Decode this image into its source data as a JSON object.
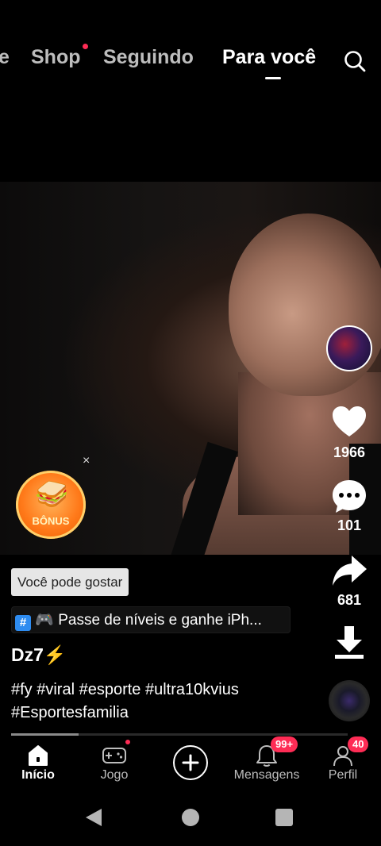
{
  "top_tabs": {
    "partial": "e",
    "shop": "Shop",
    "following": "Seguindo",
    "for_you": "Para você"
  },
  "video": {
    "bonus_label": "BÔNUS",
    "bonus_close": "×"
  },
  "actions": {
    "likes": "1966",
    "comments": "101",
    "shares": "681"
  },
  "caption": {
    "suggestion": "Você pode gostar",
    "game_badge": "#",
    "game_text": "🎮 Passe de níveis e ganhe iPh...",
    "username": "Dz7⚡",
    "hashtags": "#fy #viral #esporte #ultra10kvius #Esportesfamilia",
    "progress": 0.2
  },
  "bottom_nav": {
    "home": "Início",
    "game": "Jogo",
    "messages": "Mensagens",
    "messages_badge": "99+",
    "profile": "Perfil",
    "profile_badge": "40"
  },
  "colors": {
    "accent": "#fe2c55",
    "background": "#000000"
  }
}
